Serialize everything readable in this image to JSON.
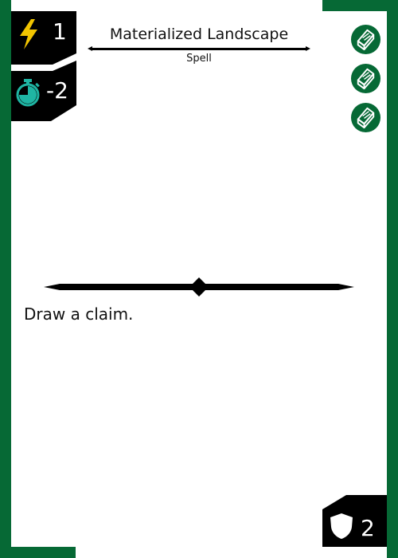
{
  "card": {
    "title": "Materialized Landscape",
    "type_line": "Spell",
    "ability_text": "Draw a claim.",
    "colors": {
      "border": "#066935",
      "panel": "#000000",
      "accent": "#1fb5a3",
      "lightning": "#f2c500"
    }
  },
  "stats": {
    "energy": {
      "icon": "lightning-icon",
      "value": "1"
    },
    "time": {
      "icon": "stopwatch-icon",
      "value": "-2"
    },
    "defense": {
      "icon": "shield-icon",
      "value": "2"
    }
  },
  "badges": [
    {
      "icon": "card-stack-icon"
    },
    {
      "icon": "card-stack-icon"
    },
    {
      "icon": "card-stack-icon"
    }
  ]
}
